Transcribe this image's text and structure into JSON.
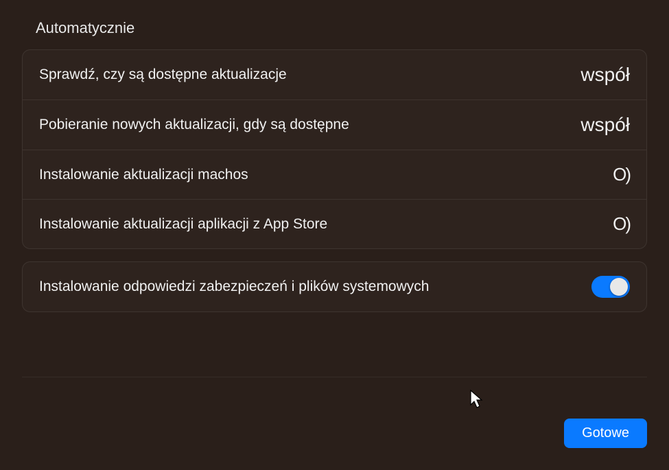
{
  "section_title": "Automatycznie",
  "group1": {
    "rows": [
      {
        "label": "Sprawdź, czy są dostępne aktualizacje",
        "value": "współ"
      },
      {
        "label": "Pobieranie nowych aktualizacji, gdy są dostępne",
        "value": "współ"
      },
      {
        "label": "Instalowanie aktualizacji machos",
        "value": "O)"
      },
      {
        "label": "Instalowanie aktualizacji aplikacji z App Store",
        "value": "O)"
      }
    ]
  },
  "group2": {
    "row": {
      "label": "Instalowanie odpowiedzi zabezpieczeń i plików systemowych",
      "toggle_on": true
    }
  },
  "footer": {
    "done_label": "Gotowe"
  }
}
